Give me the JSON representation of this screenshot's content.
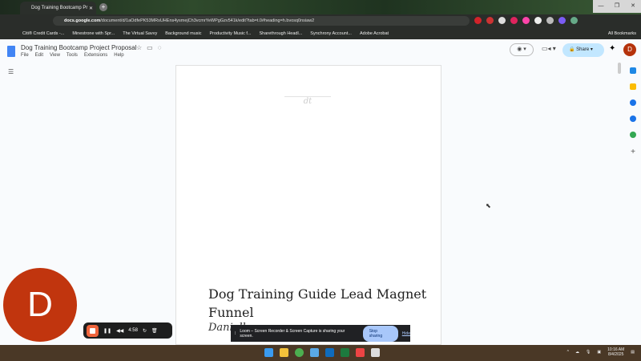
{
  "browser": {
    "tab_title": "Dog Training Bootcamp Pr",
    "url_domain": "docs.google.com",
    "url_path": "/document/d/1aOdfePK53MRsUHEns4ysmejCh3vcmrYeWPgGzv541k/edit?tab=t.0#heading=h.bvosq0nsiaw2",
    "bookmarks": [
      "Citi® Credit Cards -...",
      "Minestrone with Spr...",
      "The Virtual Savvy",
      "Background music",
      "Productivity Music f...",
      "Sharethrough Headl...",
      "Synchrony Account...",
      "Adobe Acrobat"
    ],
    "all_bookmarks": "All Bookmarks"
  },
  "doc": {
    "title": "Dog Training Bootcamp Project Proposal",
    "menu": [
      "File",
      "Edit",
      "View",
      "Tools",
      "Extensions",
      "Help"
    ],
    "share_label": "Share",
    "avatar": "D",
    "logo_text": "dt",
    "heading": "Dog Training Guide Lead Magnet Funnel",
    "subtitle": "Danielle"
  },
  "recorder": {
    "camera_initial": "D",
    "timer": "4:58"
  },
  "sharing": {
    "message": "Loom – Screen Recorder & Screen Capture is sharing your screen.",
    "stop": "Stop sharing",
    "hide": "Hide"
  },
  "taskbar": {
    "time": "10:16 AM",
    "date": "8/4/2025"
  }
}
